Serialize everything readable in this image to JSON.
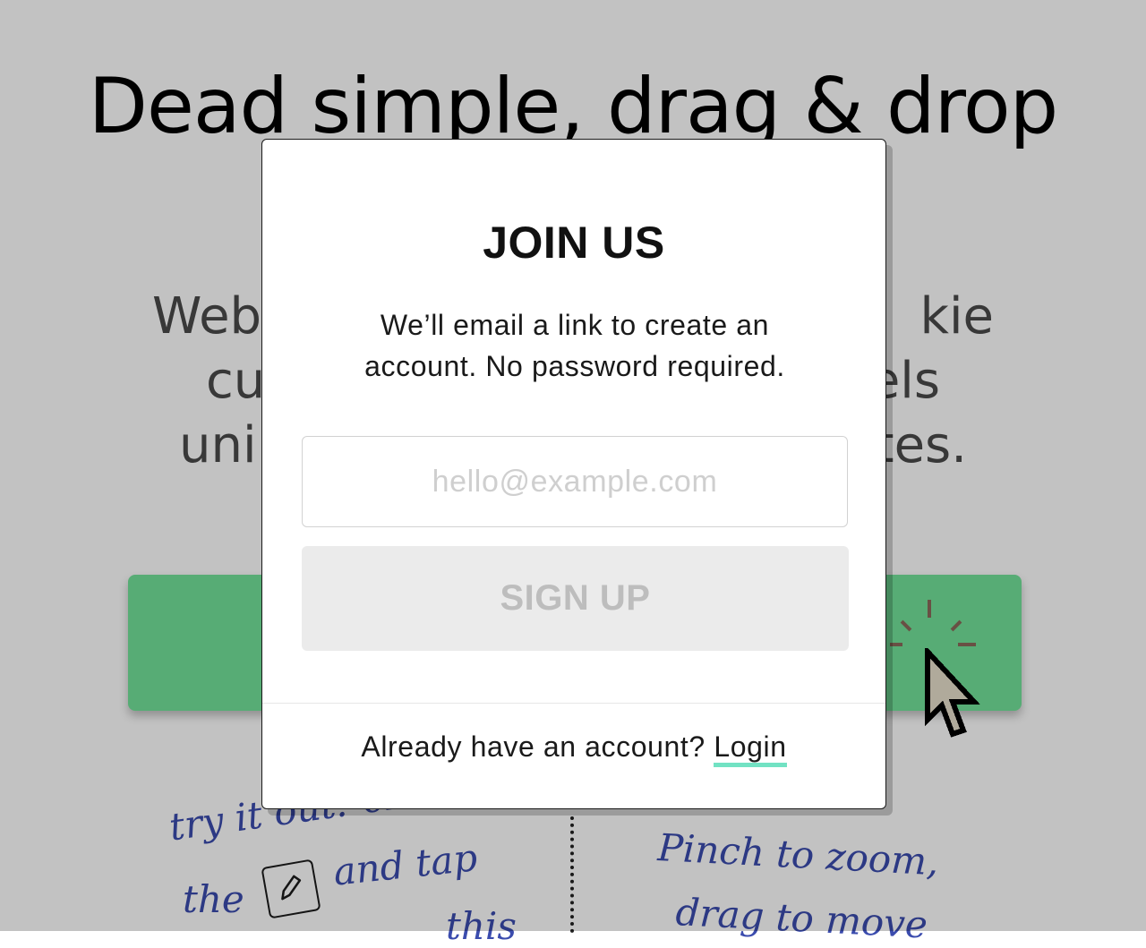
{
  "background": {
    "headline": "Dead simple, drag & drop",
    "subtext_lines": [
      "Web",
      "kie",
      "cu",
      "els",
      "uni",
      "tes."
    ],
    "cta_color": "#73e29a",
    "handwriting": {
      "line1": "try it out! click",
      "line2_pre": "the",
      "line2_post": "and tap",
      "line3": "this",
      "right1": "Pinch to zoom,",
      "right2": "drag to move"
    },
    "icons": {
      "pencil": "pencil-icon",
      "cursor": "pointer-cursor-icon"
    }
  },
  "modal": {
    "title": "JOIN US",
    "description": "We’ll email a link to create an account. No password required.",
    "email_placeholder": "hello@example.com",
    "email_value": "",
    "signup_label": "SIGN UP",
    "footer_text": "Already have an account?",
    "login_label": "Login",
    "accent_color": "#72e2c3"
  }
}
